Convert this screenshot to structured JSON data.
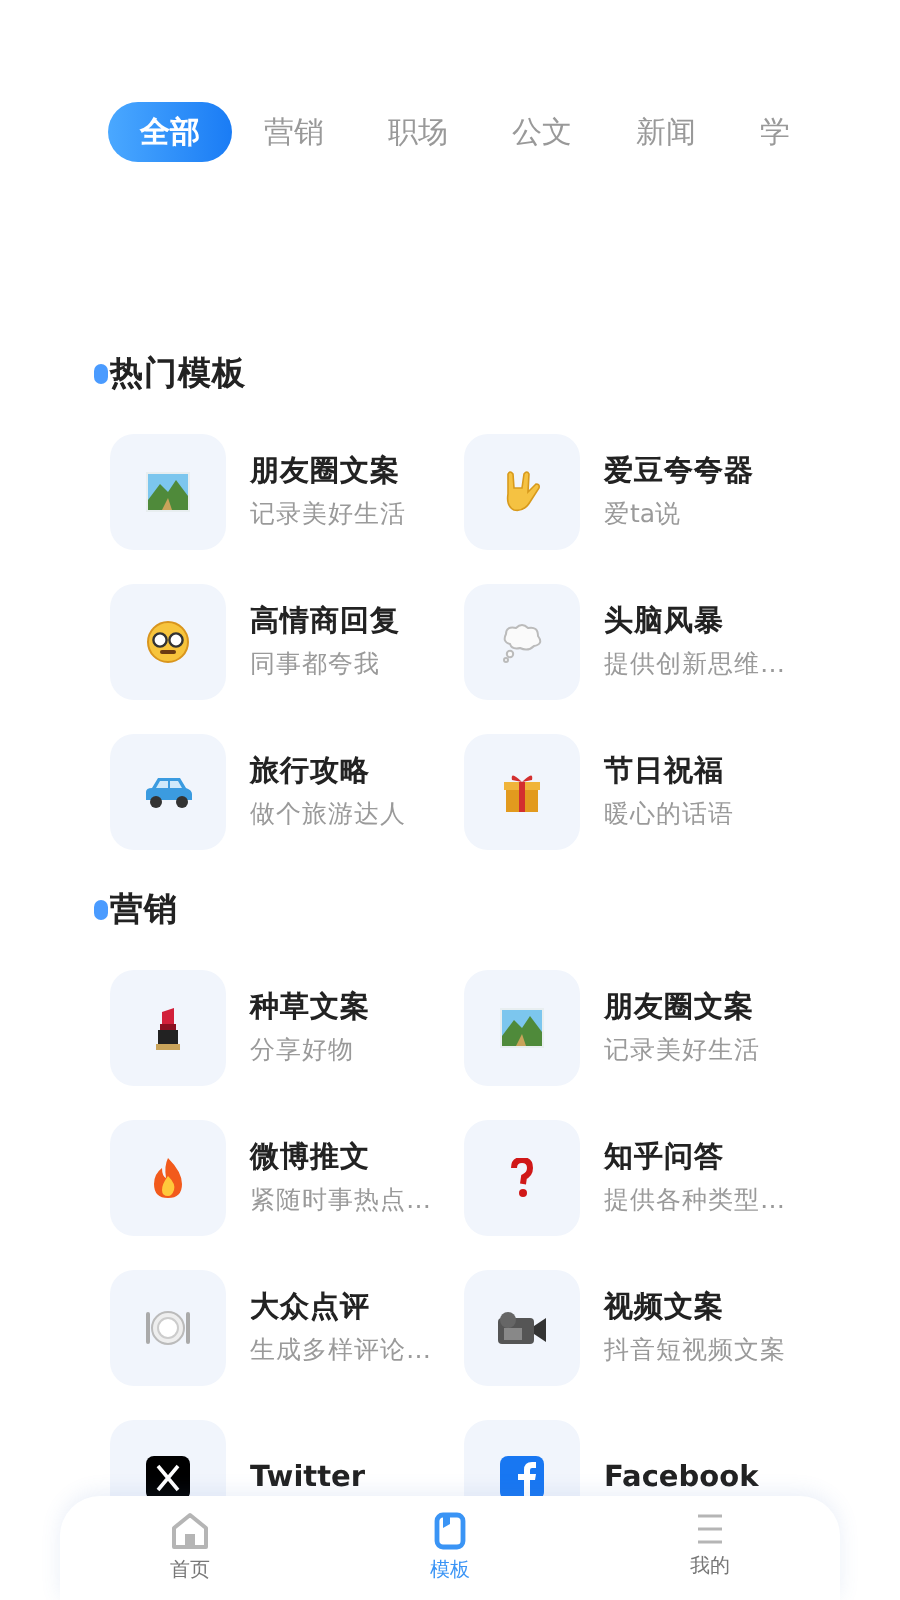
{
  "tabs": [
    {
      "label": "全部",
      "selected": true
    },
    {
      "label": "营销",
      "selected": false
    },
    {
      "label": "职场",
      "selected": false
    },
    {
      "label": "公文",
      "selected": false
    },
    {
      "label": "新闻",
      "selected": false
    },
    {
      "label": "学",
      "selected": false
    }
  ],
  "sections": [
    {
      "title": "热门模板",
      "items": [
        {
          "title": "朋友圈文案",
          "subtitle": "记录美好生活"
        },
        {
          "title": "爱豆夸夸器",
          "subtitle": "爱ta说"
        },
        {
          "title": "高情商回复",
          "subtitle": "同事都夸我"
        },
        {
          "title": "头脑风暴",
          "subtitle": "提供创新思维…"
        },
        {
          "title": "旅行攻略",
          "subtitle": "做个旅游达人"
        },
        {
          "title": "节日祝福",
          "subtitle": "暖心的话语"
        }
      ]
    },
    {
      "title": "营销",
      "items": [
        {
          "title": "种草文案",
          "subtitle": "分享好物"
        },
        {
          "title": "朋友圈文案",
          "subtitle": "记录美好生活"
        },
        {
          "title": "微博推文",
          "subtitle": "紧随时事热点…"
        },
        {
          "title": "知乎问答",
          "subtitle": "提供各种类型…"
        },
        {
          "title": "大众点评",
          "subtitle": "生成多样评论…"
        },
        {
          "title": "视频文案",
          "subtitle": "抖音短视频文案"
        },
        {
          "title": "Twitter"
        },
        {
          "title": "Facebook"
        }
      ]
    }
  ],
  "bottom_nav": [
    {
      "label": "首页",
      "selected": false
    },
    {
      "label": "模板",
      "selected": true
    },
    {
      "label": "我的",
      "selected": false
    }
  ]
}
